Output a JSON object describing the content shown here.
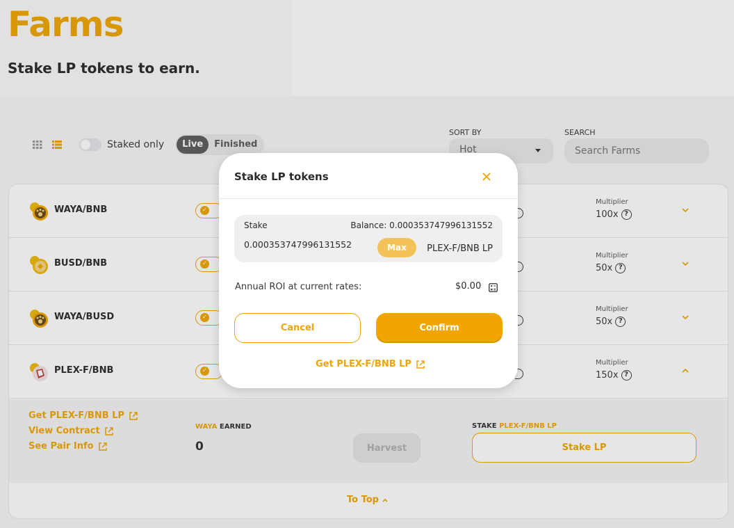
{
  "page": {
    "title": "Farms",
    "subtitle": "Stake LP tokens to earn."
  },
  "controls": {
    "grid_view_icon": "grid-icon",
    "list_view_icon": "list-icon",
    "staked_only_label": "Staked only",
    "tabs": [
      "Live",
      "Finished"
    ],
    "sort_label": "SORT BY",
    "sort_value": "Hot",
    "search_label": "SEARCH",
    "search_placeholder": "Search Farms"
  },
  "farms": [
    {
      "name": "WAYA/BNB",
      "multiplier_label": "Multiplier",
      "multiplier": "100x",
      "core_label": "C"
    },
    {
      "name": "BUSD/BNB",
      "multiplier_label": "Multiplier",
      "multiplier": "50x",
      "core_label": "C"
    },
    {
      "name": "WAYA/BUSD",
      "multiplier_label": "Multiplier",
      "multiplier": "50x",
      "core_label": "C"
    },
    {
      "name": "PLEX-F/BNB",
      "multiplier_label": "Multiplier",
      "multiplier": "150x",
      "core_label": "C"
    }
  ],
  "details": {
    "links": [
      "Get PLEX-F/BNB LP",
      "View Contract",
      "See Pair Info"
    ],
    "earned_token": "WAYA",
    "earned_label": "EARNED",
    "earned_value": "0",
    "harvest_label": "Harvest",
    "stake_prefix": "STAKE",
    "stake_token": "PLEX-F/BNB LP",
    "stake_button": "Stake LP",
    "to_top": "To Top"
  },
  "modal": {
    "title": "Stake LP tokens",
    "stake_label": "Stake",
    "balance": "Balance: 0.000353747996131552",
    "amount": "0.000353747996131552",
    "max_label": "Max",
    "token": "PLEX-F/BNB LP",
    "roi_label": "Annual ROI at current rates:",
    "roi_value": "$0.00",
    "cancel_label": "Cancel",
    "confirm_label": "Confirm",
    "get_lp_label": "Get PLEX-F/BNB LP"
  },
  "colors": {
    "accent": "#f0a500",
    "text_dark": "#2b2b2b",
    "muted_bg": "#efefef"
  }
}
